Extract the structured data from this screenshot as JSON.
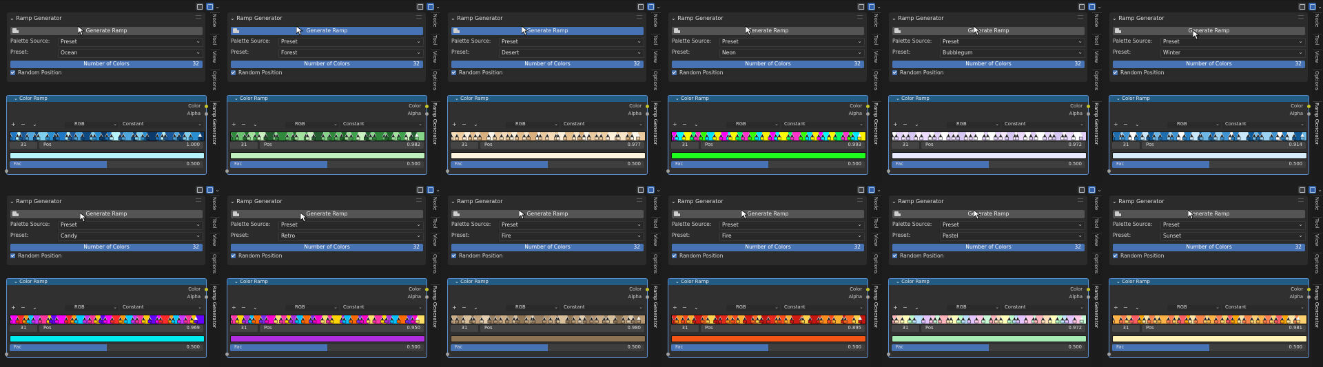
{
  "panel_title": "Ramp Generator",
  "generate_label": "Generate Ramp",
  "palette_source_label": "Palette Source:",
  "preset_label": "Preset:",
  "number_of_colors_label": "Number of Colors",
  "random_position_label": "Random Position",
  "node_title": "Color Ramp",
  "color_output_label": "Color",
  "alpha_output_label": "Alpha",
  "rgb_label": "RGB",
  "interp_label": "Constant",
  "pos_label": "Pos",
  "fac_label": "Fac",
  "tabs": {
    "node": "Node",
    "tool": "Tool",
    "view": "View",
    "options": "Options",
    "ramp": "Ramp Generator"
  },
  "tool_plus": "+",
  "tool_minus": "−",
  "icons": [
    "restrict-icon",
    "overlay-icon",
    "chevron-down-icon",
    "script-icon",
    "chevron-down-icon",
    "plus-icon",
    "minus-icon",
    "checkbox-icon",
    "cursor-icon"
  ],
  "cells": [
    {
      "palette_source": "Preset",
      "preset": "Ocean",
      "num_colors": "32",
      "stop_index": "31",
      "pos": "1.000",
      "fac": "0.500",
      "fac_fraction": 0.5,
      "swatch": "#b7f3fb",
      "colors": [
        "#1f78c4",
        "#b7f3fb",
        "#1c5a99",
        "#4fa6dc",
        "#0e4a82",
        "#7fd0ee",
        "#2a8fd0",
        "#0b3a6b"
      ],
      "gen_highlight": false,
      "cursor": [
        113,
        20
      ]
    },
    {
      "palette_source": "Preset",
      "preset": "Forest",
      "num_colors": "32",
      "stop_index": "31",
      "pos": "0.982",
      "fac": "0.500",
      "fac_fraction": 0.5,
      "swatch": "#bff0bd",
      "colors": [
        "#2f8a3b",
        "#69c26f",
        "#1e6b2a",
        "#a3e29e",
        "#3fa34e",
        "#c9f2c0",
        "#245e30",
        "#86d48a"
      ],
      "gen_highlight": true,
      "cursor": [
        110,
        20
      ]
    },
    {
      "palette_source": "Preset",
      "preset": "Desert",
      "num_colors": "32",
      "stop_index": "31",
      "pos": "0.977",
      "fac": "0.500",
      "fac_fraction": 0.5,
      "swatch": "#fff4de",
      "colors": [
        "#f6dcb8",
        "#efcfa2",
        "#fff1dc",
        "#e6c08f",
        "#fbe5c8",
        "#d9b07e",
        "#fff8ea",
        "#eccaa0"
      ],
      "gen_highlight": true,
      "cursor": [
        117,
        20
      ]
    },
    {
      "palette_source": "Preset",
      "preset": "Neon",
      "num_colors": "32",
      "stop_index": "31",
      "pos": "0.993",
      "fac": "0.500",
      "fac_fraction": 0.5,
      "swatch": "#1eff1e",
      "colors": [
        "#ff00ff",
        "#00ffff",
        "#ffff00",
        "#00ff66",
        "#ff33cc",
        "#33ff00",
        "#00e5ff",
        "#fff200"
      ],
      "gen_highlight": false,
      "cursor": [
        122,
        20
      ]
    },
    {
      "palette_source": "Preset",
      "preset": "Bubblegum",
      "num_colors": "32",
      "stop_index": "31",
      "pos": "0.972",
      "fac": "0.500",
      "fac_fraction": 0.5,
      "swatch": "#e9e9ff",
      "colors": [
        "#ffffff",
        "#e8d6ff",
        "#f7e9ff",
        "#d9c7f5",
        "#fff2ff",
        "#eddcff",
        "#ffffff",
        "#e2cffa"
      ],
      "gen_highlight": false,
      "cursor": [
        133,
        20
      ]
    },
    {
      "palette_source": "Preset",
      "preset": "Winter",
      "num_colors": "32",
      "stop_index": "31",
      "pos": "0.914",
      "fac": "0.500",
      "fac_fraction": 0.5,
      "swatch": "#d7ecfb",
      "colors": [
        "#1f6fb0",
        "#9cd2f2",
        "#3f95d4",
        "#ffffff",
        "#2a82c6",
        "#c9e8fb",
        "#0f5a98",
        "#6db8e6"
      ],
      "gen_highlight": false,
      "cursor": [
        131,
        26
      ]
    },
    {
      "palette_source": "Preset",
      "preset": "Candy",
      "num_colors": "32",
      "stop_index": "31",
      "pos": "0.969",
      "fac": "0.500",
      "fac_fraction": 0.5,
      "swatch": "#00ecef",
      "colors": [
        "#ff00ff",
        "#ff2a2a",
        "#ff9900",
        "#00ccff",
        "#cc33ff",
        "#ff3399",
        "#ffcc00",
        "#6600ff"
      ],
      "gen_highlight": false,
      "cursor": [
        116,
        25
      ]
    },
    {
      "palette_source": "Preset",
      "preset": "Retro",
      "num_colors": "32",
      "stop_index": "31",
      "pos": "0.950",
      "fac": "0.500",
      "fac_fraction": 0.5,
      "swatch": "#b02ee0",
      "colors": [
        "#ff33aa",
        "#ffd400",
        "#b02ee0",
        "#00c2ff",
        "#ff6a00",
        "#7a2ef0",
        "#ff00cc",
        "#ffe066"
      ],
      "gen_highlight": false,
      "cursor": [
        116,
        25
      ]
    },
    {
      "palette_source": "Preset",
      "preset": "Fire",
      "num_colors": "32",
      "stop_index": "31",
      "pos": "0.980",
      "fac": "0.500",
      "fac_fraction": 0.5,
      "swatch": "#8b7354",
      "colors": [
        "#c9ab86",
        "#a58b6a",
        "#d8bf9c",
        "#8e7556",
        "#bfa27c",
        "#e3cfb0",
        "#9a8062",
        "#b49672"
      ],
      "gen_highlight": false,
      "cursor": [
        113,
        21
      ]
    },
    {
      "palette_source": "Preset",
      "preset": "Fire",
      "num_colors": "32",
      "stop_index": "31",
      "pos": "0.895",
      "fac": "0.500",
      "fac_fraction": 0.5,
      "swatch": "#f35517",
      "colors": [
        "#e6281c",
        "#ff8c1a",
        "#ff4d1a",
        "#ffb02e",
        "#d11a12",
        "#ff6a1f",
        "#ffd24a",
        "#c4160f"
      ],
      "gen_highlight": false,
      "cursor": [
        116,
        21
      ]
    },
    {
      "palette_source": "Preset",
      "preset": "Pastel",
      "num_colors": "32",
      "stop_index": "31",
      "pos": "0.972",
      "fac": "0.500",
      "fac_fraction": 0.5,
      "swatch": "#a6ebb4",
      "colors": [
        "#ffb3ba",
        "#ffdfba",
        "#ffffba",
        "#baffc9",
        "#bae1ff",
        "#e3c4ff",
        "#ffc8e6",
        "#c7f7d4"
      ],
      "gen_highlight": false,
      "cursor": [
        133,
        21
      ]
    },
    {
      "palette_source": "Preset",
      "preset": "Sunset",
      "num_colors": "32",
      "stop_index": "31",
      "pos": "0.981",
      "fac": "0.500",
      "fac_fraction": 0.5,
      "swatch": "#fff2b6",
      "colors": [
        "#ffb347",
        "#ff7f50",
        "#ffd166",
        "#ff5e62",
        "#ffa600",
        "#ffe3a3",
        "#f9844a",
        "#ffcf70"
      ],
      "gen_highlight": false,
      "cursor": [
        124,
        21
      ]
    }
  ]
}
